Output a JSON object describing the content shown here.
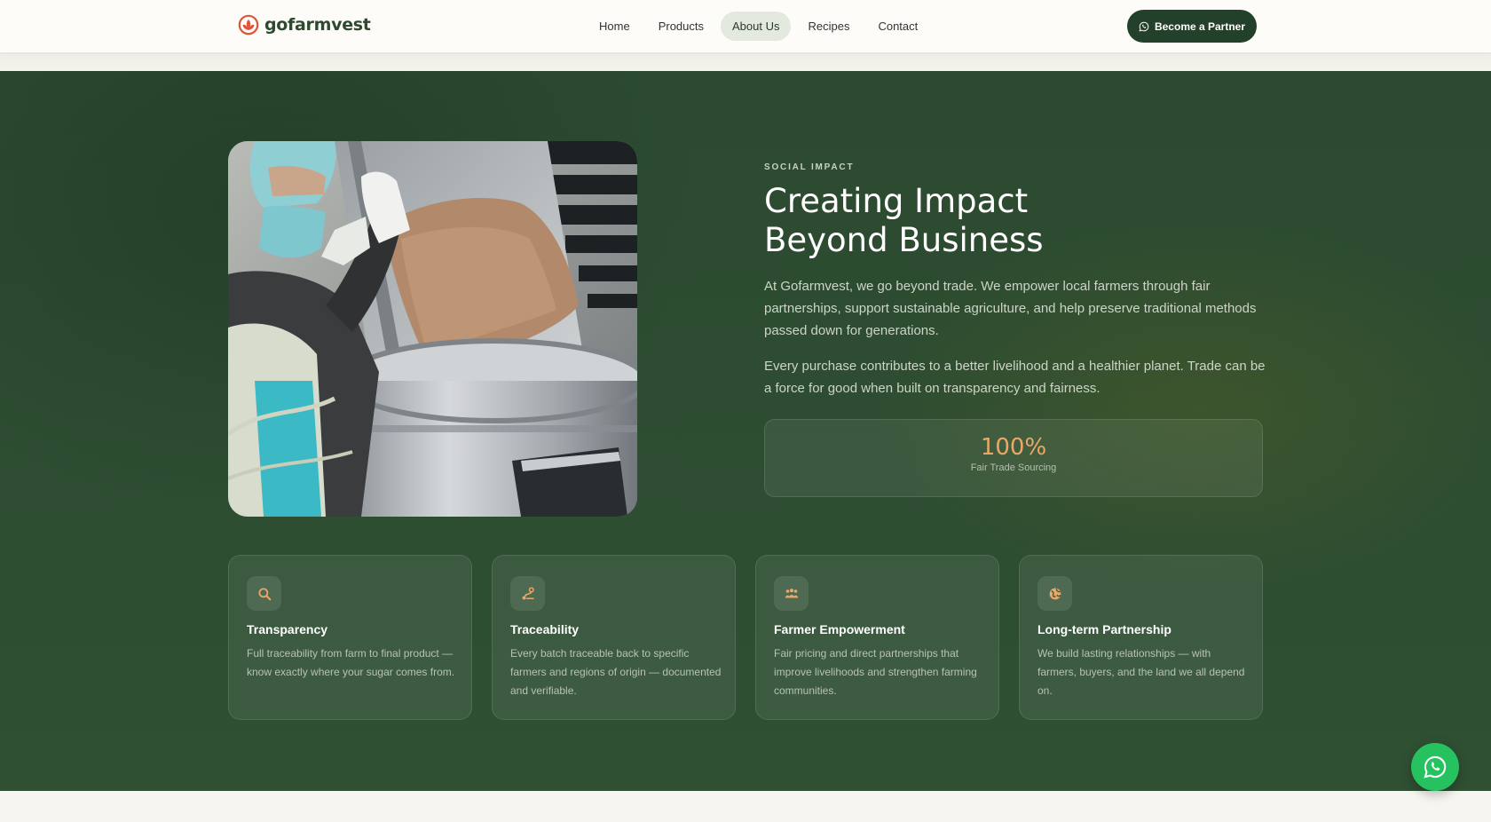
{
  "brand": {
    "name": "gofarmvest",
    "logo_color": "#e0533a"
  },
  "nav": {
    "items": [
      {
        "label": "Home",
        "active": false
      },
      {
        "label": "Products",
        "active": false
      },
      {
        "label": "About Us",
        "active": true
      },
      {
        "label": "Recipes",
        "active": false
      },
      {
        "label": "Contact",
        "active": false
      }
    ],
    "cta_label": "Become a Partner",
    "cta_icon": "whatsapp-icon"
  },
  "hero": {
    "image_alt": "worker in protective gear pouring sugar into a steel processing drum",
    "eyebrow": "SOCIAL IMPACT",
    "title_line1": "Creating Impact",
    "title_line2": "Beyond Business",
    "paragraph1": "At Gofarmvest, we go beyond trade. We empower local farmers through fair partnerships, support sustainable agriculture, and help preserve traditional methods passed down for generations.",
    "paragraph2": "Every purchase contributes to a better livelihood and a healthier planet. Trade can be a force for good when built on transparency and fairness.",
    "stat": {
      "value": "100%",
      "label": "Fair Trade Sourcing"
    }
  },
  "features": [
    {
      "icon": "search-icon",
      "title": "Transparency",
      "description": "Full traceability from farm to final product — know exactly where your sugar comes from."
    },
    {
      "icon": "route-icon",
      "title": "Traceability",
      "description": "Every batch traceable back to specific farmers and regions of origin — documented and verifiable."
    },
    {
      "icon": "people-icon",
      "title": "Farmer Empowerment",
      "description": "Fair pricing and direct partnerships that improve livelihoods and strengthen farming communities."
    },
    {
      "icon": "globe-icon",
      "title": "Long-term Partnership",
      "description": "We build lasting relationships — with farmers, buyers, and the land we all depend on."
    }
  ],
  "colors": {
    "primary_green": "#23402a",
    "accent_orange": "#e9a868",
    "whatsapp_green": "#25c25f"
  },
  "fab": {
    "icon": "whatsapp-icon"
  }
}
